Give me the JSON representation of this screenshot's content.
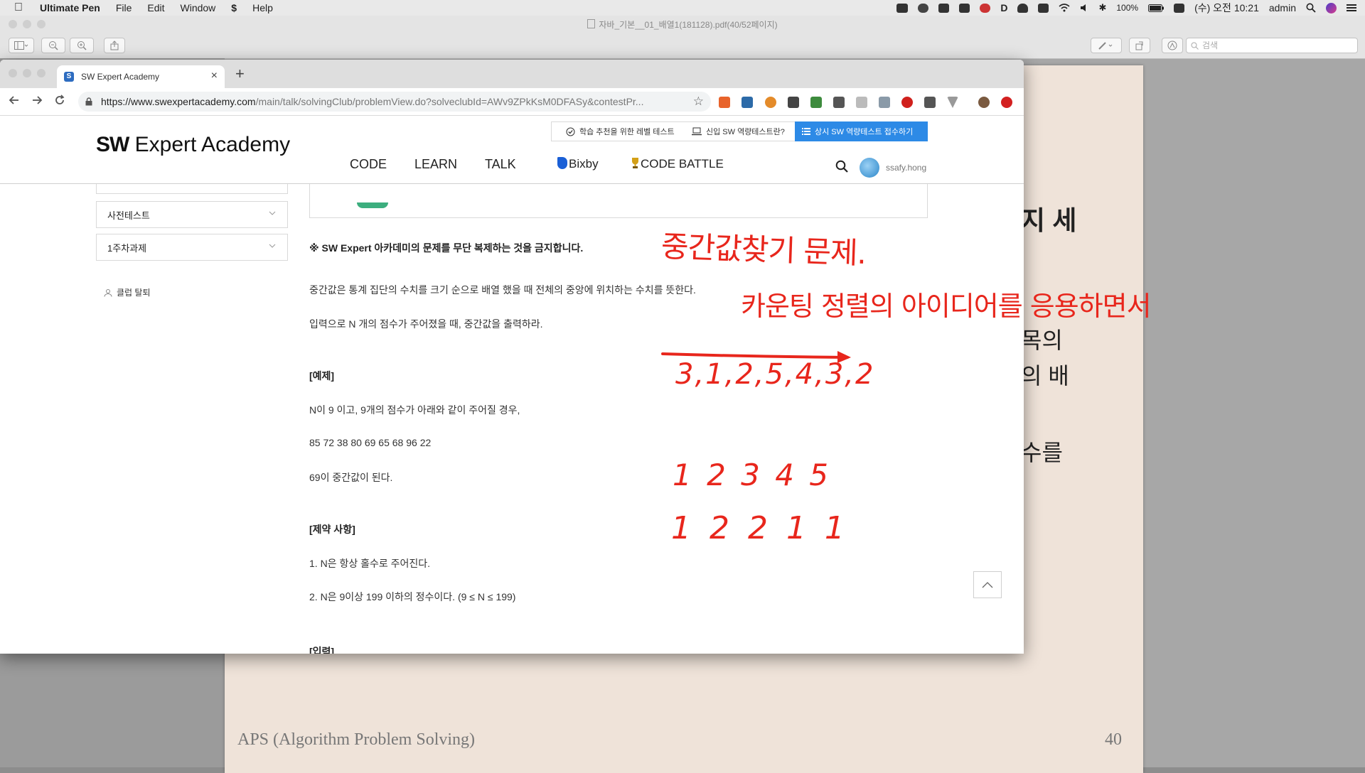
{
  "menubar": {
    "app_name": "Ultimate Pen",
    "menus": [
      "File",
      "Edit",
      "Window",
      "$",
      "Help"
    ],
    "battery": "100%",
    "clock": "(수) 오전 10:21",
    "user": "admin"
  },
  "pdf_viewer": {
    "title": "자바_기본__01_배열1(181128).pdf(40/52페이지)",
    "search_placeholder": "검색",
    "page": {
      "heading_fragment": "지 세",
      "text_fragments": [
        "목의",
        "의 배",
        "수를"
      ],
      "footer_left": "APS (Algorithm Problem Solving)",
      "footer_right": "40"
    }
  },
  "browser": {
    "tab_title": "SW Expert Academy",
    "new_tab": "+",
    "url_prefix": "https://www.swexpertacademy.com",
    "url_rest": "/main/talk/solvingClub/problemView.do?solveclubId=AWv9ZPkKsM0DFASy&contestPr..."
  },
  "site": {
    "logo_bold": "SW",
    "logo_rest": "Expert Academy",
    "top_links": [
      "학습 추천을 위한 레벨 테스트",
      "신입 SW 역량테스트란?",
      "상시 SW 역량테스트 접수하기"
    ],
    "nav": [
      "CODE",
      "LEARN",
      "TALK",
      "Bixby",
      "CODE BATTLE"
    ],
    "username": "ssafy.hong",
    "sidebar": {
      "items": [
        "사전테스트",
        "1주차과제"
      ],
      "leave_club": "클럽 탈퇴"
    },
    "problem": {
      "copyright": "※ SW Expert 아카데미의 문제를 무단 복제하는 것을 금지합니다.",
      "desc1": "중간값은 통계 집단의 수치를 크기 순으로 배열 했을 때 전체의 중앙에 위치하는 수치를 뜻한다.",
      "desc2": "입력으로 N 개의 점수가 주어졌을 때, 중간값을 출력하라.",
      "example_heading": "[예제]",
      "example_line1": "N이 9 이고, 9개의 점수가 아래와 같이 주어질 경우,",
      "example_scores": "85 72 38 80 69 65 68 96 22",
      "example_result": "69이 중간값이 된다.",
      "constraints_heading": "[제약 사항]",
      "constraint1": "1. N은 항상 홀수로 주어진다.",
      "constraint2": "2. N은 9이상 199 이하의 정수이다. (9 ≤ N ≤ 199)",
      "next_heading": "[입력]"
    }
  },
  "annotations": {
    "line1": "중간값찾기 문제.",
    "line2": "카운팅 정렬의 아이디어를 응용하면서",
    "sequence": "3,1,2,5,4,3,2",
    "keys": "1 2 3 4 5",
    "counts": "1 2 2 1 1"
  },
  "colors": {
    "accent_blue": "#2d8ae6",
    "annotation_red": "#e8261c",
    "pdf_page_bg": "#efe3d9"
  }
}
